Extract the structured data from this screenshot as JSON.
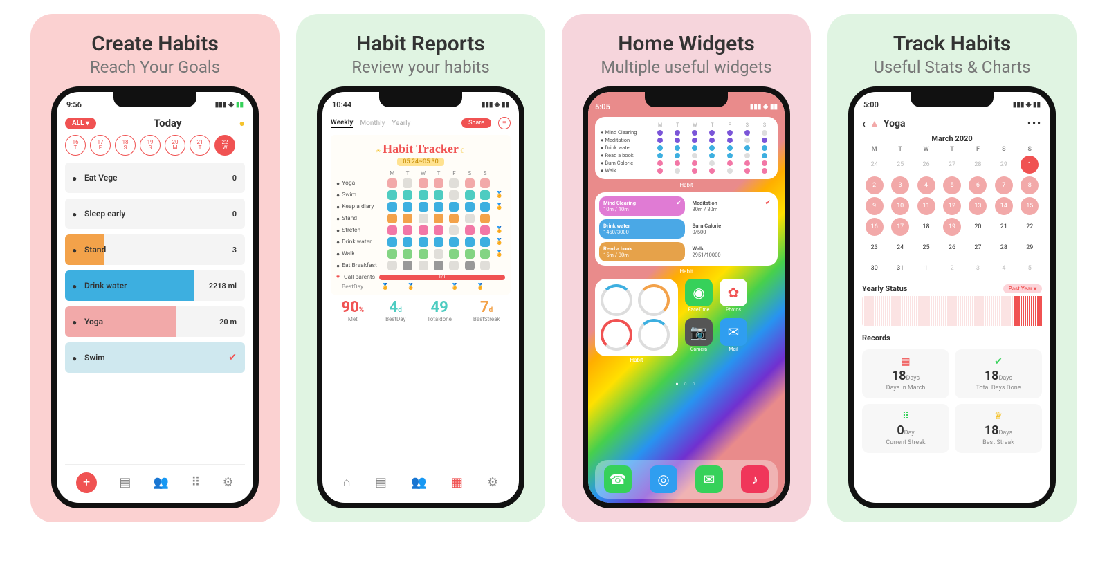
{
  "panels": [
    {
      "title": "Create Habits",
      "subtitle": "Reach Your Goals"
    },
    {
      "title": "Habit Reports",
      "subtitle": "Review your habits"
    },
    {
      "title": "Home Widgets",
      "subtitle": "Multiple useful widgets"
    },
    {
      "title": "Track Habits",
      "subtitle": "Useful Stats & Charts"
    }
  ],
  "p1": {
    "time": "9:56",
    "filter": "ALL ▾",
    "title": "Today",
    "days": [
      {
        "n": "16",
        "d": "T"
      },
      {
        "n": "17",
        "d": "F"
      },
      {
        "n": "18",
        "d": "S"
      },
      {
        "n": "19",
        "d": "S"
      },
      {
        "n": "20",
        "d": "M"
      },
      {
        "n": "21",
        "d": "T"
      },
      {
        "n": "22",
        "d": "W"
      }
    ],
    "habits": [
      {
        "name": "Eat Vege",
        "value": "0",
        "fill": 0,
        "color": "#ecebea"
      },
      {
        "name": "Sleep early",
        "value": "0",
        "fill": 0,
        "color": "#ecebea"
      },
      {
        "name": "Stand",
        "value": "3",
        "fill": 22,
        "color": "#f3a24a"
      },
      {
        "name": "Drink water",
        "value": "2218 ml",
        "fill": 72,
        "color": "#3dafe0"
      },
      {
        "name": "Yoga",
        "value": "20 m",
        "fill": 62,
        "color": "#f2a9a9"
      },
      {
        "name": "Swim",
        "value": "",
        "fill": 100,
        "color": "#cfe8ef",
        "check": true
      }
    ]
  },
  "p2": {
    "time": "10:44",
    "tabs": [
      "Weekly",
      "Monthly",
      "Yearly"
    ],
    "share": "Share",
    "tracker_title": "Habit Tracker",
    "range": "05.24~05.30",
    "days": [
      "M",
      "T",
      "W",
      "T",
      "F",
      "S",
      "S"
    ],
    "rows": [
      {
        "name": "Yoga",
        "c": "#f2a9a9",
        "p": [
          1,
          0,
          1,
          1,
          0,
          1,
          1
        ]
      },
      {
        "name": "Swim",
        "c": "#4eccc1",
        "p": [
          1,
          1,
          1,
          1,
          0,
          1,
          1
        ]
      },
      {
        "name": "Keep a diary",
        "c": "#3dafe0",
        "p": [
          1,
          1,
          1,
          1,
          1,
          1,
          1
        ]
      },
      {
        "name": "Stand",
        "c": "#f3a24a",
        "p": [
          1,
          1,
          0,
          1,
          1,
          0,
          1
        ]
      },
      {
        "name": "Stretch",
        "c": "#f277a6",
        "p": [
          1,
          1,
          1,
          1,
          0,
          1,
          1
        ]
      },
      {
        "name": "Drink water",
        "c": "#3dafe0",
        "p": [
          1,
          1,
          1,
          1,
          1,
          1,
          1
        ]
      },
      {
        "name": "Walk",
        "c": "#83d483",
        "p": [
          1,
          1,
          1,
          0,
          1,
          1,
          1
        ]
      },
      {
        "name": "Eat Breakfast",
        "c": "#999",
        "p": [
          0,
          1,
          0,
          1,
          0,
          1,
          0
        ]
      }
    ],
    "call": {
      "name": "Call parents",
      "done": "1/1"
    },
    "bestday": "BestDay",
    "summary": [
      {
        "v": "90",
        "u": "%",
        "l": "Met",
        "c": "#f05252"
      },
      {
        "v": "4",
        "u": "d",
        "l": "BestDay",
        "c": "#4eccc1"
      },
      {
        "v": "49",
        "u": "",
        "l": "Totaldone",
        "c": "#4eccc1"
      },
      {
        "v": "7",
        "u": "d",
        "l": "BestStreak",
        "c": "#f3a24a"
      }
    ]
  },
  "p3": {
    "time": "5:05",
    "widget_days": [
      "M",
      "T",
      "W",
      "T",
      "F",
      "S",
      "S"
    ],
    "w1": [
      {
        "name": "Mind Clearing",
        "c": "#7a55d8",
        "p": [
          1,
          1,
          1,
          1,
          1,
          1,
          0
        ]
      },
      {
        "name": "Meditation",
        "c": "#7a55d8",
        "p": [
          1,
          1,
          1,
          1,
          1,
          0,
          1
        ]
      },
      {
        "name": "Drink water",
        "c": "#3dafe0",
        "p": [
          1,
          1,
          1,
          1,
          1,
          1,
          1
        ]
      },
      {
        "name": "Read a book",
        "c": "#3dafe0",
        "p": [
          1,
          1,
          0,
          1,
          1,
          0,
          1
        ]
      },
      {
        "name": "Burn Calorie",
        "c": "#f277a6",
        "p": [
          1,
          1,
          1,
          0,
          1,
          1,
          1
        ]
      },
      {
        "name": "Walk",
        "c": "#f277a6",
        "p": [
          1,
          0,
          1,
          1,
          0,
          1,
          1
        ]
      }
    ],
    "label": "Habit",
    "w2": [
      {
        "t": "Mind Clearing",
        "s": "10m / 10m",
        "bg": "#e07bd4",
        "chk": true
      },
      {
        "t": "Meditation",
        "s": "30m / 30m",
        "lt": true,
        "chk": true
      },
      {
        "t": "Drink water",
        "s": "1450/3000",
        "bg": "#4aa8e6"
      },
      {
        "t": "Burn Calorie",
        "s": "0/500",
        "lt": true
      },
      {
        "t": "Read a book",
        "s": "15m / 30m",
        "bg": "#e6a24a"
      },
      {
        "t": "Walk",
        "s": "2951/10000",
        "lt": true
      }
    ],
    "apps_row": [
      {
        "name": "FaceTime",
        "bg": "#36d15a",
        "g": "◉"
      },
      {
        "name": "Photos",
        "bg": "#fff",
        "g": "✿"
      }
    ],
    "apps_row2": [
      {
        "name": "Camera",
        "bg": "#555",
        "g": "📷"
      },
      {
        "name": "Mail",
        "bg": "#2f9ef0",
        "g": "✉"
      }
    ],
    "dock": [
      {
        "bg": "#36d15a",
        "g": "☎"
      },
      {
        "bg": "#2f9ef0",
        "g": "◎"
      },
      {
        "bg": "#36d15a",
        "g": "✉"
      },
      {
        "bg": "#f0365a",
        "g": "♪"
      }
    ]
  },
  "p4": {
    "time": "5:00",
    "title": "Yoga",
    "month": "March 2020",
    "dh": [
      "M",
      "T",
      "W",
      "T",
      "F",
      "S",
      "S"
    ],
    "weeks": [
      [
        {
          "n": 24,
          "s": "off"
        },
        {
          "n": 25,
          "s": "off"
        },
        {
          "n": 26,
          "s": "off"
        },
        {
          "n": 27,
          "s": "off"
        },
        {
          "n": 28,
          "s": "off"
        },
        {
          "n": 29,
          "s": "off"
        },
        {
          "n": 1,
          "s": "red"
        }
      ],
      [
        {
          "n": 2,
          "s": "on"
        },
        {
          "n": 3,
          "s": "on"
        },
        {
          "n": 4,
          "s": "on"
        },
        {
          "n": 5,
          "s": "on"
        },
        {
          "n": 6,
          "s": "on"
        },
        {
          "n": 7,
          "s": "on"
        },
        {
          "n": 8,
          "s": "on"
        }
      ],
      [
        {
          "n": 9,
          "s": "on"
        },
        {
          "n": 10,
          "s": "on"
        },
        {
          "n": 11,
          "s": "on"
        },
        {
          "n": 12,
          "s": "on"
        },
        {
          "n": 13,
          "s": "on"
        },
        {
          "n": 14,
          "s": "on"
        },
        {
          "n": 15,
          "s": "on"
        }
      ],
      [
        {
          "n": 16,
          "s": "on"
        },
        {
          "n": 17,
          "s": "on"
        },
        {
          "n": 18,
          "s": ""
        },
        {
          "n": 19,
          "s": "on"
        },
        {
          "n": 20,
          "s": ""
        },
        {
          "n": 21,
          "s": ""
        },
        {
          "n": 22,
          "s": ""
        }
      ],
      [
        {
          "n": 23,
          "s": ""
        },
        {
          "n": 24,
          "s": ""
        },
        {
          "n": 25,
          "s": ""
        },
        {
          "n": 26,
          "s": ""
        },
        {
          "n": 27,
          "s": ""
        },
        {
          "n": 28,
          "s": ""
        },
        {
          "n": 29,
          "s": ""
        }
      ],
      [
        {
          "n": 30,
          "s": ""
        },
        {
          "n": 31,
          "s": ""
        },
        {
          "n": 1,
          "s": "off"
        },
        {
          "n": 2,
          "s": "off"
        },
        {
          "n": 3,
          "s": "off"
        },
        {
          "n": 4,
          "s": "off"
        },
        {
          "n": 5,
          "s": "off"
        }
      ]
    ],
    "yearly": {
      "title": "Yearly Status",
      "tag": "Past Year ▾"
    },
    "records": {
      "title": "Records",
      "cards": [
        {
          "icon": "▦",
          "ic": "#f05252",
          "n": "18",
          "u": "Days",
          "l": "Days in March"
        },
        {
          "icon": "✔",
          "ic": "#36d15a",
          "n": "18",
          "u": "Days",
          "l": "Total Days Done"
        },
        {
          "icon": "⠿",
          "ic": "#36d15a",
          "n": "0",
          "u": "Day",
          "l": "Current Streak"
        },
        {
          "icon": "♛",
          "ic": "#f5c32c",
          "n": "18",
          "u": "Days",
          "l": "Best Streak"
        }
      ]
    }
  }
}
